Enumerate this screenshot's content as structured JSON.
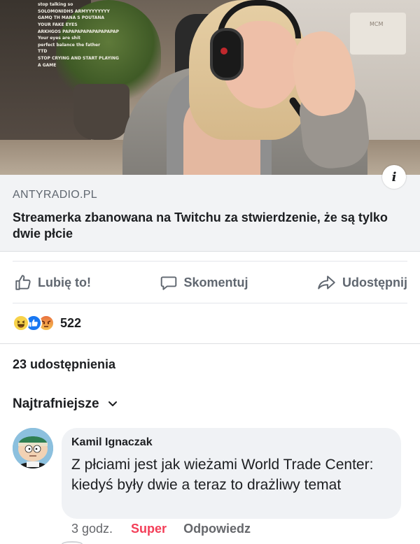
{
  "link_preview": {
    "chat_lines": [
      {
        "user": "",
        "text": "stop talking so"
      },
      {
        "user": "",
        "text": "SOLOMONIDHS ARMYYYYYYYY"
      },
      {
        "user": "",
        "text": "GAMQ TH MANA S POUTANA"
      },
      {
        "user": "",
        "text": "YOUR FAKE EYES"
      },
      {
        "user": "",
        "text": "ARKHGOS PAPAPAPAPAPAPAPAPAP"
      },
      {
        "user": "",
        "text": "Your eyes are shit"
      },
      {
        "user": "",
        "text": "perfect balance the father"
      },
      {
        "user": "",
        "text": "TTD"
      },
      {
        "user": "",
        "text": "STOP CRYING AND START PLAYING"
      },
      {
        "user": "",
        "text": "A GAME"
      }
    ],
    "background_box_label": "MCM",
    "info_icon_glyph": "i",
    "domain": "ANTYRADIO.PL",
    "title": "Streamerka zbanowana na Twitchu za stwierdzenie, że są tylko dwie płcie"
  },
  "actions": {
    "like_label": "Lubię to!",
    "comment_label": "Skomentuj",
    "share_label": "Udostępnij"
  },
  "reactions": {
    "icons": [
      "haha",
      "like",
      "angry"
    ],
    "count": "522"
  },
  "shares": {
    "label": "23 udostępnienia"
  },
  "comments_sort": {
    "label": "Najtrafniejsze"
  },
  "comment": {
    "author": "Kamil Ignaczak",
    "text": "Z płciami jest jak  wieżami World Trade Center: kiedyś były dwie a teraz to drażliwy temat",
    "time": "3 godz.",
    "reaction_label": "Super",
    "reply_label": "Odpowiedz"
  },
  "colors": {
    "facebook_blue": "#1877f2",
    "text_primary": "#1c1e21",
    "text_secondary": "#606770",
    "super_red": "#f33e58",
    "bubble_bg": "#f0f2f5"
  }
}
